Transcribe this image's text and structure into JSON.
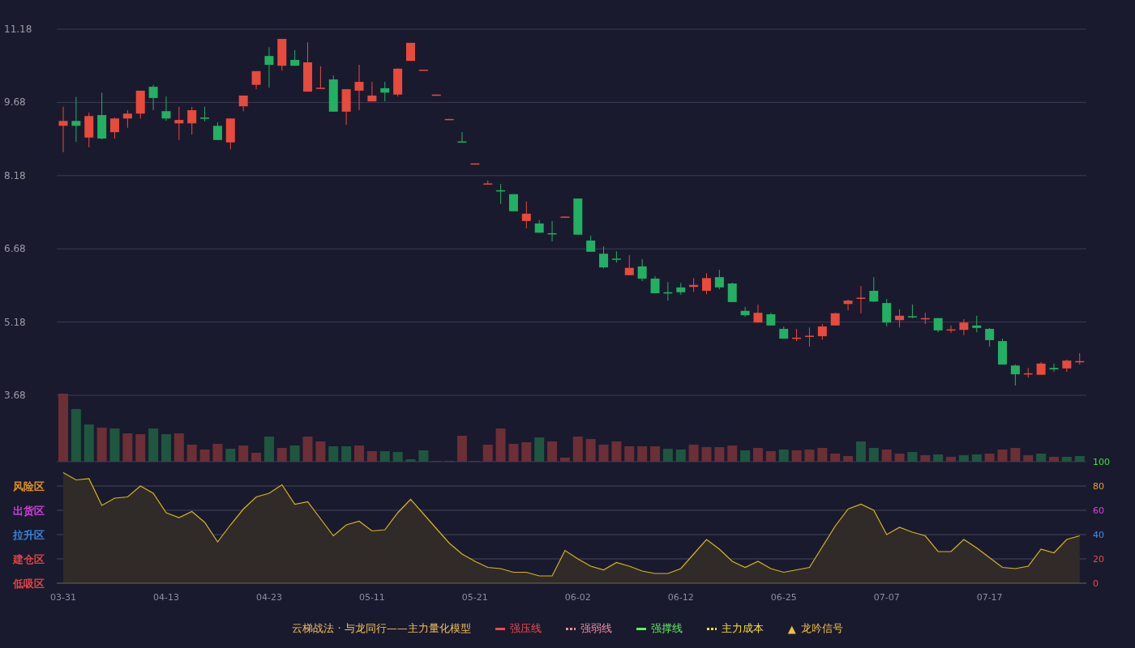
{
  "price_chart": {
    "chart_data": {
      "type": "candlestick",
      "yticks": [
        11.18,
        9.68,
        8.18,
        6.68,
        5.18,
        3.68
      ],
      "ylim": [
        3.68,
        11.18
      ],
      "grid": true,
      "categories": [
        null,
        null,
        null,
        null,
        null,
        null,
        null,
        null,
        null,
        null,
        null,
        null,
        null,
        null,
        null,
        null,
        null,
        null,
        null,
        null,
        null,
        null,
        null,
        null,
        null,
        null,
        null,
        null,
        null,
        null,
        null,
        null,
        null,
        null,
        null,
        null,
        null,
        null,
        null,
        null,
        null,
        null,
        null,
        null,
        null,
        null,
        null,
        null,
        null,
        null,
        null,
        null,
        null,
        null,
        null,
        null,
        null,
        null,
        null,
        null,
        null,
        null,
        null,
        null,
        null,
        null,
        null,
        null,
        null,
        null,
        null,
        null,
        null,
        null,
        null,
        null,
        null,
        null,
        null,
        null
      ],
      "ohlc": [
        [
          9.2,
          9.59,
          8.66,
          9.3
        ],
        [
          9.3,
          9.79,
          8.87,
          9.2
        ],
        [
          8.96,
          9.47,
          8.76,
          9.4
        ],
        [
          9.42,
          9.88,
          8.92,
          8.94
        ],
        [
          9.07,
          9.37,
          8.94,
          9.35
        ],
        [
          9.35,
          9.52,
          9.16,
          9.45
        ],
        [
          9.45,
          9.92,
          9.35,
          9.92
        ],
        [
          10.0,
          10.04,
          9.52,
          9.77
        ],
        [
          9.5,
          9.8,
          9.3,
          9.35
        ],
        [
          9.25,
          9.59,
          8.91,
          9.32
        ],
        [
          9.25,
          9.59,
          9.02,
          9.52
        ],
        [
          9.37,
          9.59,
          9.29,
          9.35
        ],
        [
          9.2,
          9.27,
          8.91,
          8.91
        ],
        [
          8.86,
          9.35,
          8.72,
          9.35
        ],
        [
          9.6,
          9.82,
          9.5,
          9.82
        ],
        [
          10.04,
          10.32,
          9.95,
          10.32
        ],
        [
          10.63,
          10.81,
          9.98,
          10.45
        ],
        [
          10.43,
          10.98,
          10.33,
          10.98
        ],
        [
          10.55,
          10.75,
          10.43,
          10.43
        ],
        [
          9.9,
          10.91,
          9.9,
          10.5
        ],
        [
          9.97,
          10.42,
          9.97,
          9.98
        ],
        [
          10.15,
          10.23,
          9.49,
          9.49
        ],
        [
          9.49,
          9.95,
          9.22,
          9.95
        ],
        [
          9.92,
          10.45,
          9.52,
          10.1
        ],
        [
          9.7,
          10.1,
          9.7,
          9.82
        ],
        [
          9.97,
          10.1,
          9.7,
          9.88
        ],
        [
          9.84,
          10.38,
          9.8,
          10.37
        ],
        [
          10.53,
          10.9,
          10.53,
          10.9
        ],
        [
          10.34,
          10.35,
          10.34,
          10.35
        ],
        [
          9.82,
          9.84,
          9.82,
          9.84
        ],
        [
          9.33,
          9.34,
          9.33,
          9.34
        ],
        [
          8.88,
          9.07,
          8.87,
          8.87
        ],
        [
          8.42,
          8.43,
          8.42,
          8.43
        ],
        [
          8.01,
          8.08,
          8.01,
          8.02
        ],
        [
          7.88,
          8.01,
          7.6,
          7.86
        ],
        [
          7.8,
          7.8,
          7.45,
          7.45
        ],
        [
          7.25,
          7.65,
          7.1,
          7.4
        ],
        [
          7.2,
          7.27,
          7.01,
          7.01
        ],
        [
          7.0,
          7.25,
          6.83,
          6.99
        ],
        [
          7.33,
          7.34,
          7.33,
          7.34
        ],
        [
          7.71,
          7.71,
          6.97,
          6.97
        ],
        [
          6.85,
          6.95,
          6.62,
          6.62
        ],
        [
          6.58,
          6.73,
          6.28,
          6.3
        ],
        [
          6.48,
          6.63,
          6.4,
          6.47
        ],
        [
          6.14,
          6.55,
          6.14,
          6.29
        ],
        [
          6.32,
          6.47,
          6.02,
          6.07
        ],
        [
          6.07,
          6.12,
          5.77,
          5.77
        ],
        [
          5.79,
          6.0,
          5.62,
          5.78
        ],
        [
          5.89,
          5.98,
          5.74,
          5.79
        ],
        [
          5.9,
          6.08,
          5.8,
          5.94
        ],
        [
          5.82,
          6.18,
          5.75,
          6.08
        ],
        [
          6.1,
          6.25,
          5.85,
          5.89
        ],
        [
          5.97,
          5.99,
          5.59,
          5.59
        ],
        [
          5.41,
          5.49,
          5.29,
          5.32
        ],
        [
          5.17,
          5.54,
          5.17,
          5.37
        ],
        [
          5.34,
          5.37,
          5.11,
          5.11
        ],
        [
          5.04,
          5.09,
          4.84,
          4.84
        ],
        [
          4.85,
          5.04,
          4.79,
          4.86
        ],
        [
          4.89,
          5.07,
          4.68,
          4.9
        ],
        [
          4.89,
          5.14,
          4.82,
          5.09
        ],
        [
          5.11,
          5.37,
          5.11,
          5.36
        ],
        [
          5.55,
          5.64,
          5.42,
          5.62
        ],
        [
          5.67,
          5.92,
          5.36,
          5.68
        ],
        [
          5.82,
          6.1,
          5.59,
          5.6
        ],
        [
          5.57,
          5.65,
          5.09,
          5.17
        ],
        [
          5.22,
          5.44,
          5.07,
          5.31
        ],
        [
          5.3,
          5.54,
          5.26,
          5.29
        ],
        [
          5.25,
          5.37,
          5.14,
          5.26
        ],
        [
          5.26,
          5.26,
          4.97,
          5.01
        ],
        [
          5.02,
          5.11,
          4.96,
          5.03
        ],
        [
          5.02,
          5.24,
          4.91,
          5.17
        ],
        [
          5.11,
          5.31,
          4.97,
          5.06
        ],
        [
          5.04,
          5.06,
          4.68,
          4.81
        ],
        [
          4.79,
          4.84,
          4.31,
          4.31
        ],
        [
          4.29,
          4.31,
          3.88,
          4.11
        ],
        [
          4.12,
          4.24,
          4.04,
          4.13
        ],
        [
          4.1,
          4.36,
          4.1,
          4.33
        ],
        [
          4.24,
          4.33,
          4.16,
          4.21
        ],
        [
          4.23,
          4.41,
          4.16,
          4.39
        ],
        [
          4.36,
          4.54,
          4.31,
          4.38
        ]
      ]
    }
  },
  "oscillator": {
    "zones": [
      {
        "label": "风险区",
        "color": "#f0a020"
      },
      {
        "label": "出货区",
        "color": "#e040e8"
      },
      {
        "label": "拉升区",
        "color": "#3d8ef0"
      },
      {
        "label": "建仓区",
        "color": "#f04848"
      },
      {
        "label": "低吸区",
        "color": "#f04848"
      }
    ],
    "axis_labels": [
      {
        "label": "100",
        "color": "#40e040"
      },
      {
        "label": "80",
        "color": "#f0a020"
      },
      {
        "label": "60",
        "color": "#e040e8"
      },
      {
        "label": "40",
        "color": "#3d8ef0"
      },
      {
        "label": "20",
        "color": "#f04848"
      },
      {
        "label": "0",
        "color": "#f04848"
      }
    ],
    "chart_data": {
      "type": "area",
      "ylim": [
        0,
        100
      ],
      "grid": true,
      "yticks": [
        100,
        80,
        60,
        40,
        20,
        0
      ],
      "categories": [
        "03-31",
        null,
        null,
        null,
        null,
        null,
        null,
        null,
        "04-13",
        null,
        null,
        null,
        null,
        null,
        null,
        null,
        "04-23",
        null,
        null,
        null,
        null,
        null,
        null,
        null,
        "05-11",
        null,
        null,
        null,
        null,
        null,
        null,
        null,
        "05-21",
        null,
        null,
        null,
        null,
        null,
        null,
        null,
        "06-02",
        null,
        null,
        null,
        null,
        null,
        null,
        null,
        "06-12",
        null,
        null,
        null,
        null,
        null,
        null,
        null,
        "06-25",
        null,
        null,
        null,
        null,
        null,
        null,
        null,
        "07-07",
        null,
        null,
        null,
        null,
        null,
        null,
        null,
        "07-17",
        null,
        null,
        null,
        null,
        null,
        null,
        null
      ],
      "values": [
        91,
        85,
        86,
        64,
        70,
        71,
        80,
        74,
        58,
        54,
        59,
        50,
        34,
        48,
        61,
        71,
        74,
        81,
        65,
        67,
        53,
        39,
        48,
        51,
        43,
        44,
        58,
        69,
        57,
        45,
        33,
        24,
        18,
        13,
        12,
        9,
        9,
        6,
        6,
        27,
        20,
        14,
        11,
        17,
        14,
        10,
        8,
        8,
        12,
        24,
        36,
        28,
        18,
        13,
        18,
        12,
        9,
        11,
        13,
        30,
        47,
        61,
        65,
        60,
        40,
        46,
        42,
        39,
        26,
        26,
        36,
        29,
        21,
        13,
        12,
        14,
        28,
        25,
        36,
        39
      ]
    }
  },
  "legend": {
    "title": "云梯战法 · 与龙同行——主力量化模型",
    "items": [
      {
        "kind": "solid",
        "label": "强压线",
        "color": "#f04848"
      },
      {
        "kind": "dashed",
        "label": "强弱线",
        "color": "#f28ca0"
      },
      {
        "kind": "solid",
        "label": "强撑线",
        "color": "#5cf05c"
      },
      {
        "kind": "dashed",
        "label": "主力成本",
        "color": "#f5e02a"
      },
      {
        "kind": "marker",
        "marker": "▲",
        "label": "龙吟信号",
        "color": "#f0c040"
      }
    ]
  }
}
